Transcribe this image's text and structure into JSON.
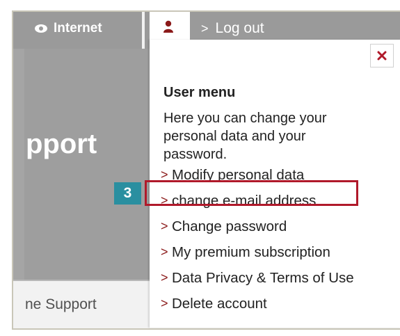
{
  "nav": {
    "internet_label": "Internet",
    "logout_label": "Log out",
    "chevron": ">"
  },
  "hero": {
    "partial_title": "pport"
  },
  "footer": {
    "partial_text": "ne Support"
  },
  "dropdown": {
    "close_symbol": "×",
    "title": "User menu",
    "description": "Here you can change your personal data and your password.",
    "items": [
      {
        "label": "Modify personal data"
      },
      {
        "label": "change e-mail address"
      },
      {
        "label": "Change password"
      },
      {
        "label": "My premium subscription"
      },
      {
        "label": "Data Privacy & Terms of Use"
      },
      {
        "label": "Delete account"
      }
    ],
    "item_chevron": ">"
  },
  "annotation": {
    "step_number": "3"
  },
  "colors": {
    "brand_red": "#8b1a1a",
    "highlight_red": "#b0192a",
    "badge_teal": "#2a8fa0",
    "nav_grey": "#9a9a9a"
  },
  "icons": {
    "internet": "eye-icon",
    "user": "user-icon",
    "close": "close-icon"
  }
}
